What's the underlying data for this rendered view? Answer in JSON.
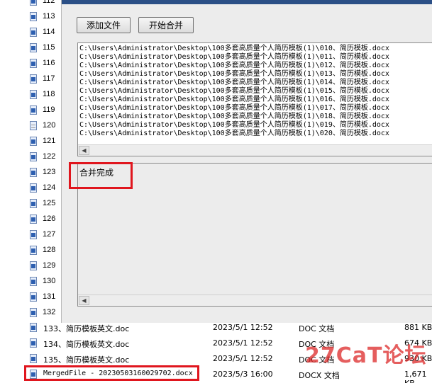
{
  "explorer": {
    "numbers": [
      {
        "num": "112",
        "plain": false
      },
      {
        "num": "113",
        "plain": false
      },
      {
        "num": "114",
        "plain": false
      },
      {
        "num": "115",
        "plain": false
      },
      {
        "num": "116",
        "plain": false
      },
      {
        "num": "117",
        "plain": false
      },
      {
        "num": "118",
        "plain": false
      },
      {
        "num": "119",
        "plain": false
      },
      {
        "num": "120",
        "plain": true
      },
      {
        "num": "121",
        "plain": false
      },
      {
        "num": "122",
        "plain": false
      },
      {
        "num": "123",
        "plain": false
      },
      {
        "num": "124",
        "plain": false
      },
      {
        "num": "125",
        "plain": false
      },
      {
        "num": "126",
        "plain": false
      },
      {
        "num": "127",
        "plain": false
      },
      {
        "num": "128",
        "plain": false
      },
      {
        "num": "129",
        "plain": false
      },
      {
        "num": "130",
        "plain": false
      },
      {
        "num": "131",
        "plain": false
      },
      {
        "num": "132",
        "plain": false
      }
    ],
    "rows": [
      {
        "name": "133、简历模板英文.doc",
        "date": "2023/5/1 12:52",
        "type": "DOC 文档",
        "size": "881 KB"
      },
      {
        "name": "134、简历模板英文.doc",
        "date": "2023/5/1 12:52",
        "type": "DOC 文档",
        "size": "674 KB"
      },
      {
        "name": "135、简历模板英文.doc",
        "date": "2023/5/1 12:52",
        "type": "DOC 文档",
        "size": "930 KB"
      },
      {
        "name": "MergedFile - 20230503160029702.docx",
        "date": "2023/5/3 16:00",
        "type": "DOCX 文档",
        "size": "1,671 KB"
      }
    ]
  },
  "dialog": {
    "add_button": "添加文件",
    "merge_button": "开始合并",
    "files": [
      "C:\\Users\\Administrator\\Desktop\\100多套高质量个人简历模板(1)\\010、简历模板.docx",
      "C:\\Users\\Administrator\\Desktop\\100多套高质量个人简历模板(1)\\011、简历模板.docx",
      "C:\\Users\\Administrator\\Desktop\\100多套高质量个人简历模板(1)\\012、简历模板.docx",
      "C:\\Users\\Administrator\\Desktop\\100多套高质量个人简历模板(1)\\013、简历模板.docx",
      "C:\\Users\\Administrator\\Desktop\\100多套高质量个人简历模板(1)\\014、简历模板.docx",
      "C:\\Users\\Administrator\\Desktop\\100多套高质量个人简历模板(1)\\015、简历模板.docx",
      "C:\\Users\\Administrator\\Desktop\\100多套高质量个人简历模板(1)\\016、简历模板.docx",
      "C:\\Users\\Administrator\\Desktop\\100多套高质量个人简历模板(1)\\017、简历模板.docx",
      "C:\\Users\\Administrator\\Desktop\\100多套高质量个人简历模板(1)\\018、简历模板.docx",
      "C:\\Users\\Administrator\\Desktop\\100多套高质量个人简历模板(1)\\019、简历模板.docx",
      "C:\\Users\\Administrator\\Desktop\\100多套高质量个人简历模板(1)\\020、简历模板.docx"
    ],
    "status": "合并完成"
  },
  "watermark": "27CaT论坛",
  "colors": {
    "highlight": "#e0161e",
    "dialog_bg": "#ececec",
    "title_bar": "#2b4f86"
  }
}
